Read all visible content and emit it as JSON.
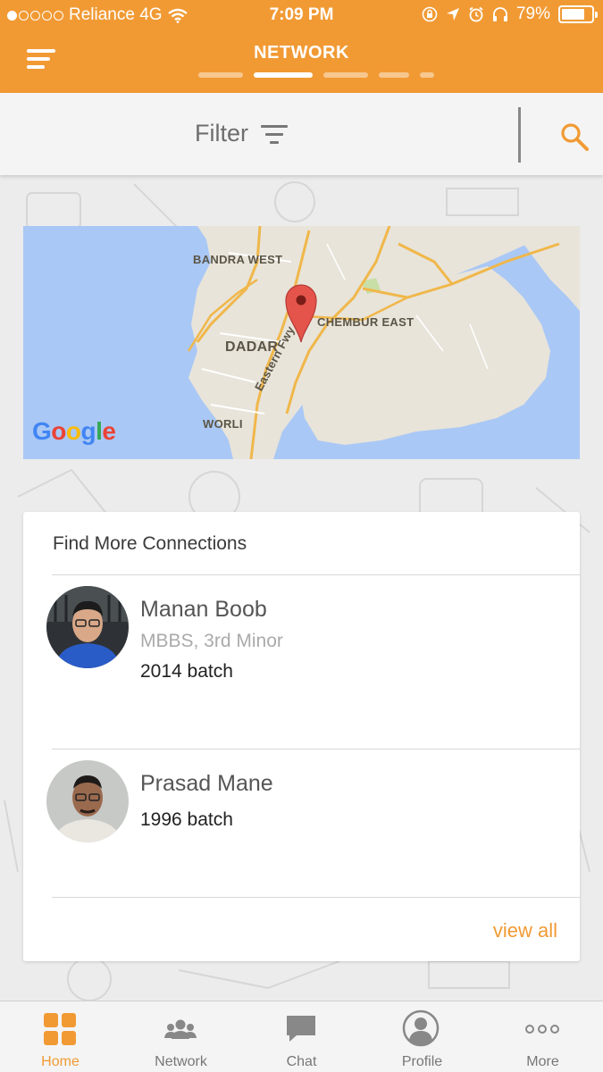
{
  "status_bar": {
    "carrier": "Reliance 4G",
    "time": "7:09 PM",
    "battery": "79%",
    "battery_level": 0.79,
    "signal_bars": 1,
    "signal_total": 5
  },
  "header": {
    "title": "NETWORK",
    "menu_icon": "hamburger-icon",
    "page_indicator_count": 5,
    "page_indicator_active": 1
  },
  "filter_bar": {
    "filter_label": "Filter",
    "filter_icon": "filter-icon",
    "search_icon": "search-icon"
  },
  "map": {
    "labels": {
      "bandra_west": "BANDRA WEST",
      "chembur_east": "CHEMBUR EAST",
      "dadar": "DADAR",
      "worli": "WORLI",
      "eastern_fwy": "Eastern Fwy"
    },
    "logo": "Google",
    "pin_icon": "map-pin-icon"
  },
  "connections_card": {
    "title": "Find More Connections",
    "people": [
      {
        "name": "Manan Boob",
        "subtitle": "MBBS, 3rd Minor",
        "batch": "2014 batch"
      },
      {
        "name": "Prasad Mane",
        "subtitle": "",
        "batch": "1996 batch"
      }
    ],
    "view_all": "view all"
  },
  "tab_bar": {
    "tabs": [
      {
        "label": "Home",
        "icon": "home-grid-icon",
        "active": true
      },
      {
        "label": "Network",
        "icon": "people-icon",
        "active": false
      },
      {
        "label": "Chat",
        "icon": "chat-bubble-icon",
        "active": false
      },
      {
        "label": "Profile",
        "icon": "profile-icon",
        "active": false
      },
      {
        "label": "More",
        "icon": "more-dots-icon",
        "active": false
      }
    ]
  },
  "colors": {
    "brand_orange": "#f19a34",
    "map_water": "#aac8f5",
    "map_land": "#e8e4da",
    "tab_inactive": "#777777"
  }
}
